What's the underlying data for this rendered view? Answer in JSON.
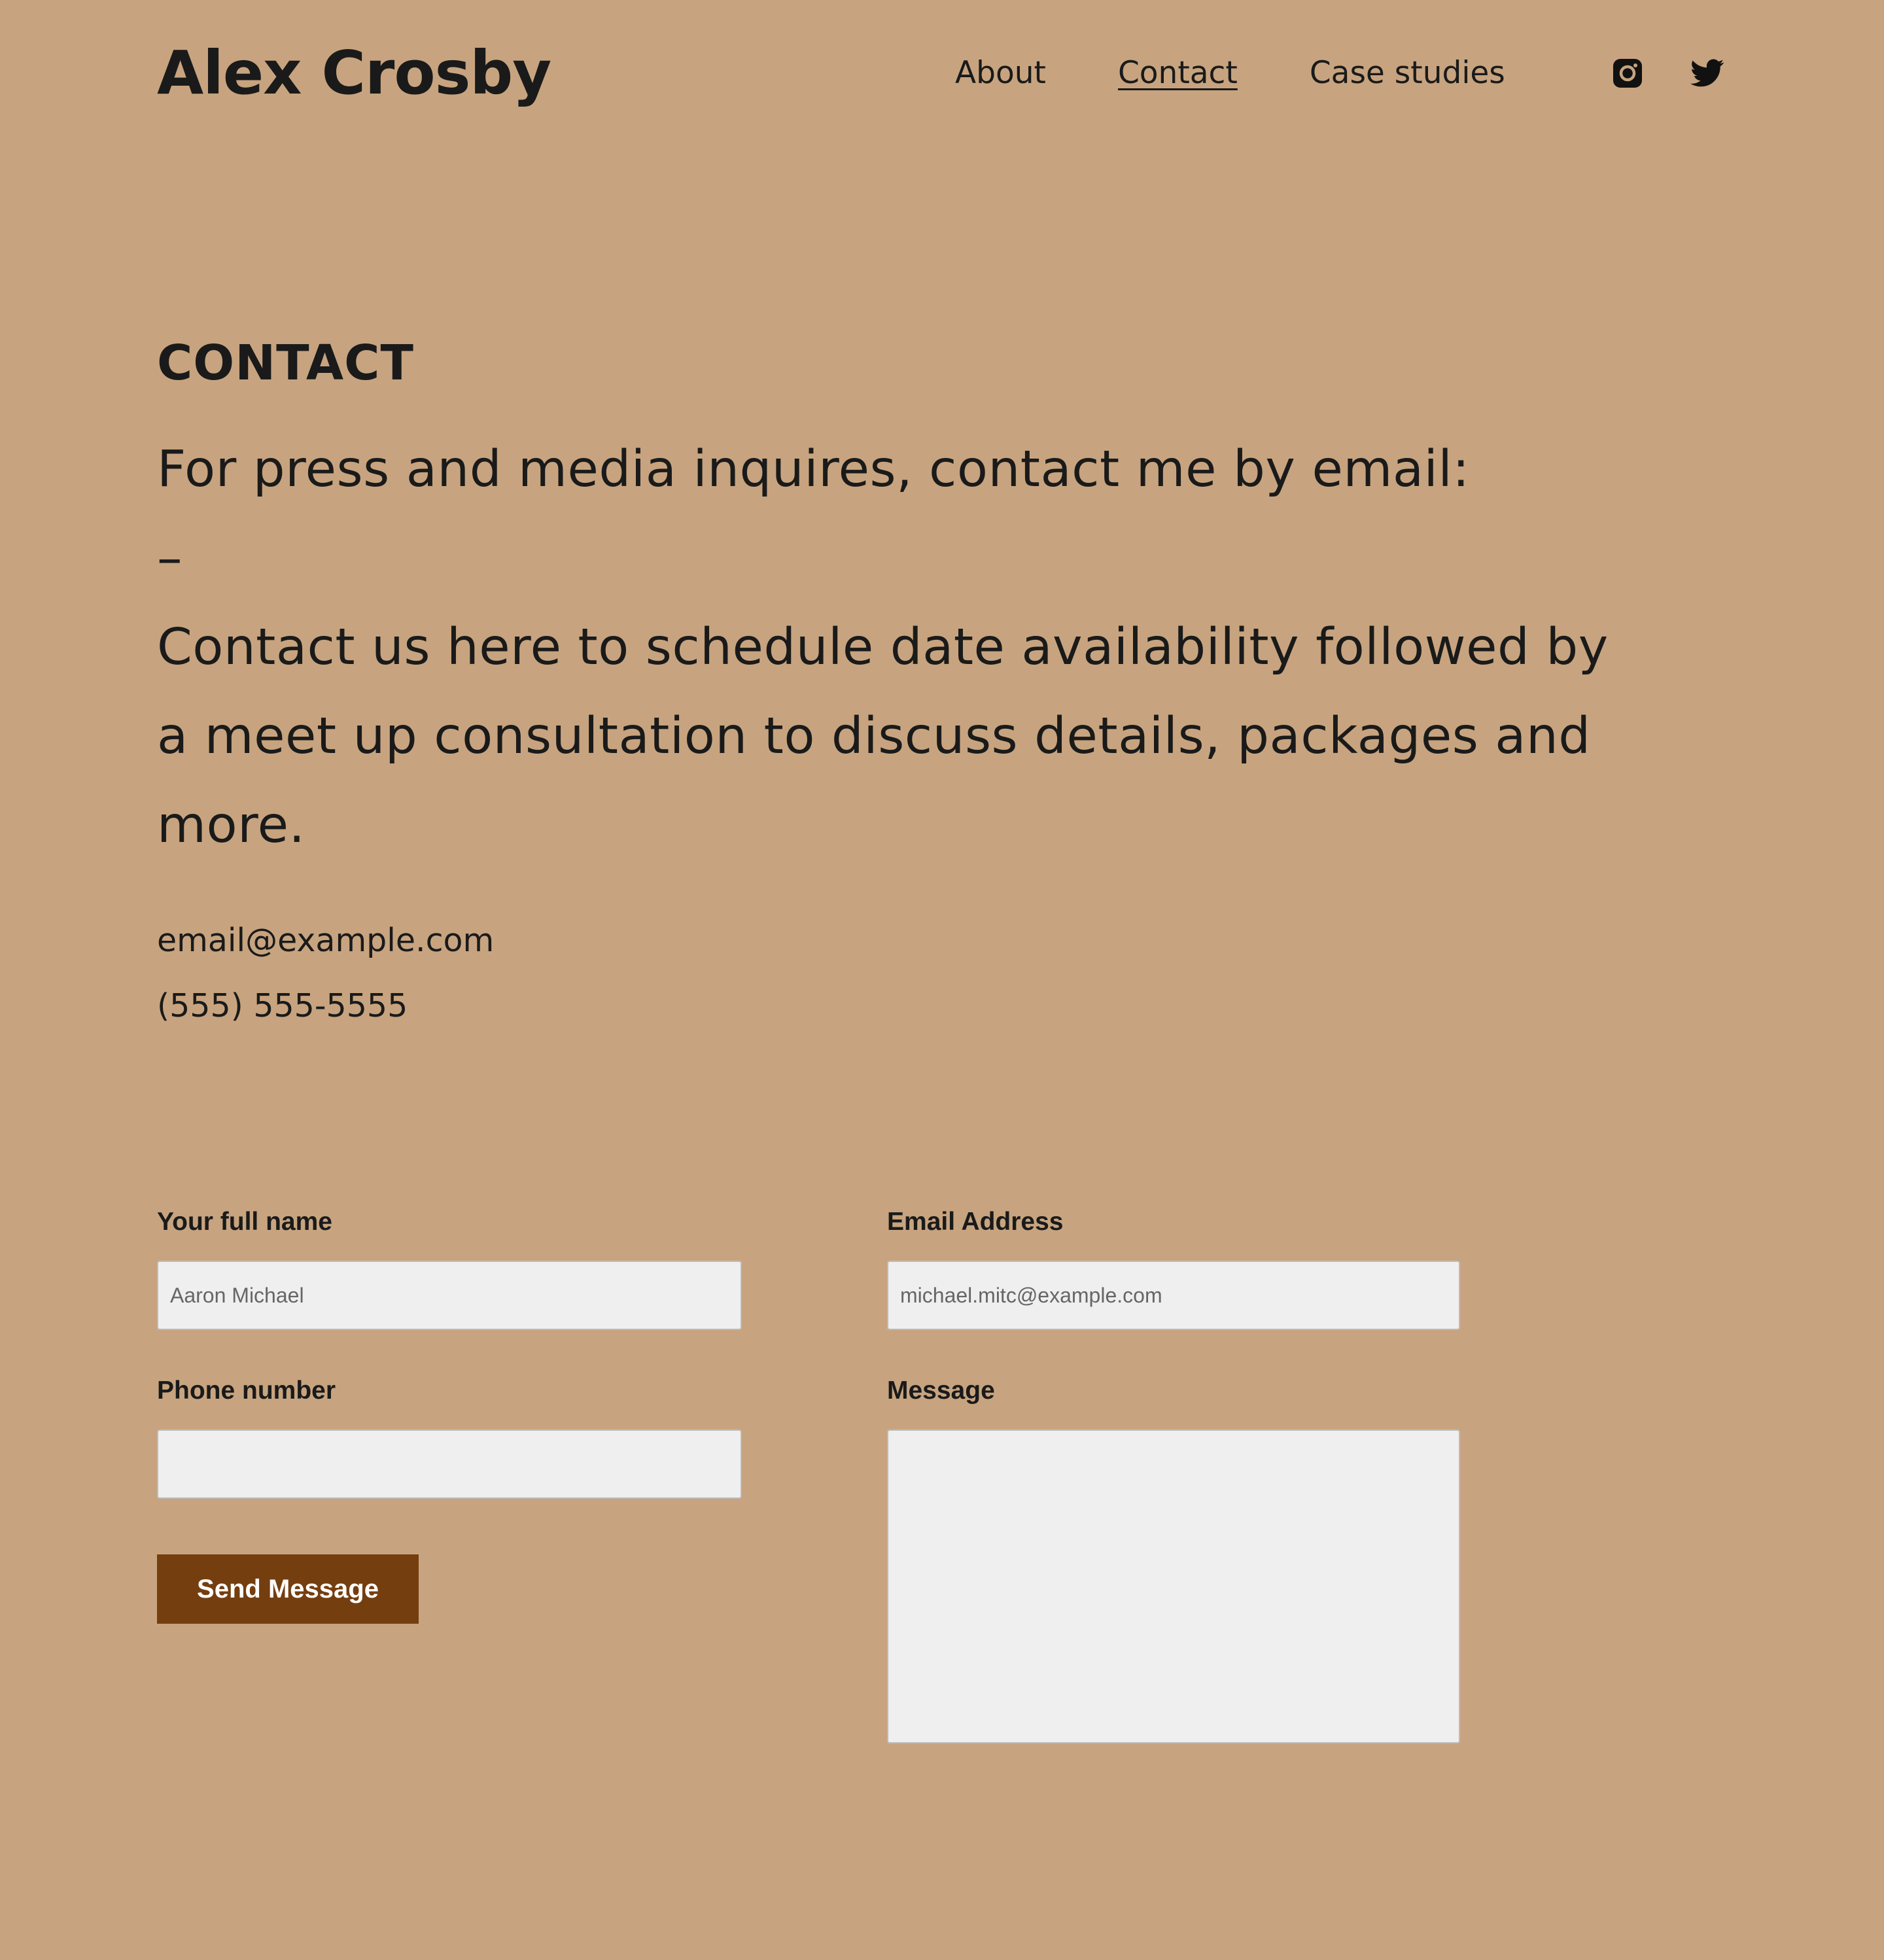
{
  "site": {
    "title": "Alex Crosby"
  },
  "nav": {
    "items": [
      {
        "label": "About"
      },
      {
        "label": "Contact",
        "current": true
      },
      {
        "label": "Case studies"
      }
    ],
    "social": [
      {
        "icon": "instagram-icon"
      },
      {
        "icon": "twitter-icon"
      }
    ]
  },
  "page": {
    "heading": "CONTACT",
    "lead_line1": "For press and media inquires, contact me by email:",
    "lead_line2": "–",
    "lead_line3": "Contact us here to schedule date availability followed by a meet up consultation to discuss details, packages and more.",
    "email": "email@example.com",
    "phone": "(555) 555-5555"
  },
  "form": {
    "name_label": "Your full name",
    "name_placeholder": "Aaron Michael",
    "email_label": "Email Address",
    "email_placeholder": "michael.mitc@example.com",
    "phone_label": "Phone number",
    "phone_placeholder": "",
    "message_label": "Message",
    "message_placeholder": "",
    "submit_label": "Send Message"
  },
  "colors": {
    "background": "#c7a47f",
    "text": "#1a1a1a",
    "button": "#753e0f",
    "input_background": "#efefef"
  }
}
